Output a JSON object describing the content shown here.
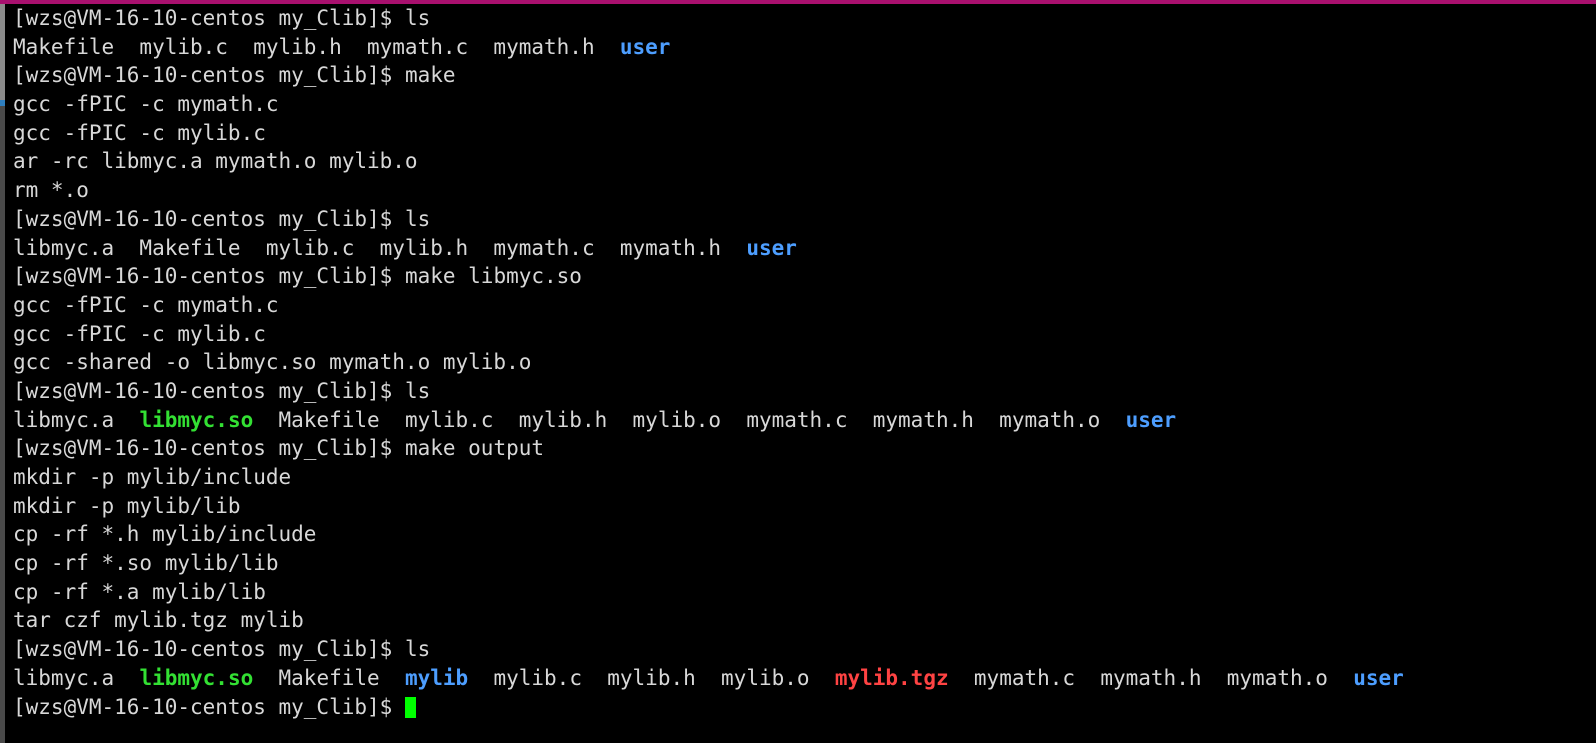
{
  "window": {
    "title": "[wzs@VM-16-10-centos my_Clib]$",
    "top_border_color": "#a8106e",
    "background_color": "#000000",
    "foreground_color": "#d8d8d8"
  },
  "scrollbar": {
    "name": "vertical-scrollbar",
    "track_color": "#4a4a4a",
    "thumb_color": "#8b8b8b"
  },
  "prompt": {
    "user": "wzs",
    "host": "VM-16-10-centos",
    "cwd": "my_Clib",
    "text": "[wzs@VM-16-10-centos my_Clib]$ "
  },
  "colors": {
    "directory": "#4d9eff",
    "shared_object": "#33e033",
    "archive": "#ff4343",
    "regular_file": "#d8d8d8",
    "cursor": "#00ff00"
  },
  "cursor": {
    "visible": true,
    "shape": "block"
  },
  "lines": [
    {
      "id": 0,
      "type": "prompt",
      "segments": [
        {
          "text": "[wzs@VM-16-10-centos my_Clib]$ ",
          "cls": "c-prompt"
        },
        {
          "text": "ls",
          "cls": "c-cmd"
        }
      ]
    },
    {
      "id": 1,
      "type": "output",
      "segments": [
        {
          "text": "Makefile  mylib.c  mylib.h  mymath.c  mymath.h  ",
          "cls": "c-default"
        },
        {
          "text": "user",
          "cls": "c-dir"
        }
      ]
    },
    {
      "id": 2,
      "type": "prompt",
      "segments": [
        {
          "text": "[wzs@VM-16-10-centos my_Clib]$ ",
          "cls": "c-prompt"
        },
        {
          "text": "make",
          "cls": "c-cmd"
        }
      ]
    },
    {
      "id": 3,
      "type": "output",
      "segments": [
        {
          "text": "gcc -fPIC -c mymath.c",
          "cls": "c-default"
        }
      ]
    },
    {
      "id": 4,
      "type": "output",
      "segments": [
        {
          "text": "gcc -fPIC -c mylib.c",
          "cls": "c-default"
        }
      ]
    },
    {
      "id": 5,
      "type": "output",
      "segments": [
        {
          "text": "ar -rc libmyc.a mymath.o mylib.o",
          "cls": "c-default"
        }
      ]
    },
    {
      "id": 6,
      "type": "output",
      "segments": [
        {
          "text": "rm *.o",
          "cls": "c-default"
        }
      ]
    },
    {
      "id": 7,
      "type": "prompt",
      "segments": [
        {
          "text": "[wzs@VM-16-10-centos my_Clib]$ ",
          "cls": "c-prompt"
        },
        {
          "text": "ls",
          "cls": "c-cmd"
        }
      ]
    },
    {
      "id": 8,
      "type": "output",
      "segments": [
        {
          "text": "libmyc.a  Makefile  mylib.c  mylib.h  mymath.c  mymath.h  ",
          "cls": "c-default"
        },
        {
          "text": "user",
          "cls": "c-dir"
        }
      ]
    },
    {
      "id": 9,
      "type": "prompt",
      "segments": [
        {
          "text": "[wzs@VM-16-10-centos my_Clib]$ ",
          "cls": "c-prompt"
        },
        {
          "text": "make libmyc.so",
          "cls": "c-cmd"
        }
      ]
    },
    {
      "id": 10,
      "type": "output",
      "segments": [
        {
          "text": "gcc -fPIC -c mymath.c",
          "cls": "c-default"
        }
      ]
    },
    {
      "id": 11,
      "type": "output",
      "segments": [
        {
          "text": "gcc -fPIC -c mylib.c",
          "cls": "c-default"
        }
      ]
    },
    {
      "id": 12,
      "type": "output",
      "segments": [
        {
          "text": "gcc -shared -o libmyc.so mymath.o mylib.o",
          "cls": "c-default"
        }
      ]
    },
    {
      "id": 13,
      "type": "prompt",
      "segments": [
        {
          "text": "[wzs@VM-16-10-centos my_Clib]$ ",
          "cls": "c-prompt"
        },
        {
          "text": "ls",
          "cls": "c-cmd"
        }
      ]
    },
    {
      "id": 14,
      "type": "output",
      "segments": [
        {
          "text": "libmyc.a  ",
          "cls": "c-default"
        },
        {
          "text": "libmyc.so",
          "cls": "c-so"
        },
        {
          "text": "  Makefile  mylib.c  mylib.h  mylib.o  mymath.c  mymath.h  mymath.o  ",
          "cls": "c-default"
        },
        {
          "text": "user",
          "cls": "c-dir"
        }
      ]
    },
    {
      "id": 15,
      "type": "prompt",
      "segments": [
        {
          "text": "[wzs@VM-16-10-centos my_Clib]$ ",
          "cls": "c-prompt"
        },
        {
          "text": "make output",
          "cls": "c-cmd"
        }
      ]
    },
    {
      "id": 16,
      "type": "output",
      "segments": [
        {
          "text": "mkdir -p mylib/include",
          "cls": "c-default"
        }
      ]
    },
    {
      "id": 17,
      "type": "output",
      "segments": [
        {
          "text": "mkdir -p mylib/lib",
          "cls": "c-default"
        }
      ]
    },
    {
      "id": 18,
      "type": "output",
      "segments": [
        {
          "text": "cp -rf *.h mylib/include",
          "cls": "c-default"
        }
      ]
    },
    {
      "id": 19,
      "type": "output",
      "segments": [
        {
          "text": "cp -rf *.so mylib/lib",
          "cls": "c-default"
        }
      ]
    },
    {
      "id": 20,
      "type": "output",
      "segments": [
        {
          "text": "cp -rf *.a mylib/lib",
          "cls": "c-default"
        }
      ]
    },
    {
      "id": 21,
      "type": "output",
      "segments": [
        {
          "text": "tar czf mylib.tgz mylib",
          "cls": "c-default"
        }
      ]
    },
    {
      "id": 22,
      "type": "prompt",
      "segments": [
        {
          "text": "[wzs@VM-16-10-centos my_Clib]$ ",
          "cls": "c-prompt"
        },
        {
          "text": "ls",
          "cls": "c-cmd"
        }
      ]
    },
    {
      "id": 23,
      "type": "output",
      "segments": [
        {
          "text": "libmyc.a  ",
          "cls": "c-default"
        },
        {
          "text": "libmyc.so",
          "cls": "c-so"
        },
        {
          "text": "  Makefile  ",
          "cls": "c-default"
        },
        {
          "text": "mylib",
          "cls": "c-dir"
        },
        {
          "text": "  mylib.c  mylib.h  mylib.o  ",
          "cls": "c-default"
        },
        {
          "text": "mylib.tgz",
          "cls": "c-archive"
        },
        {
          "text": "  mymath.c  mymath.h  mymath.o  ",
          "cls": "c-default"
        },
        {
          "text": "user",
          "cls": "c-dir"
        }
      ]
    },
    {
      "id": 24,
      "type": "prompt-active",
      "segments": [
        {
          "text": "[wzs@VM-16-10-centos my_Clib]$ ",
          "cls": "c-prompt"
        }
      ]
    }
  ]
}
